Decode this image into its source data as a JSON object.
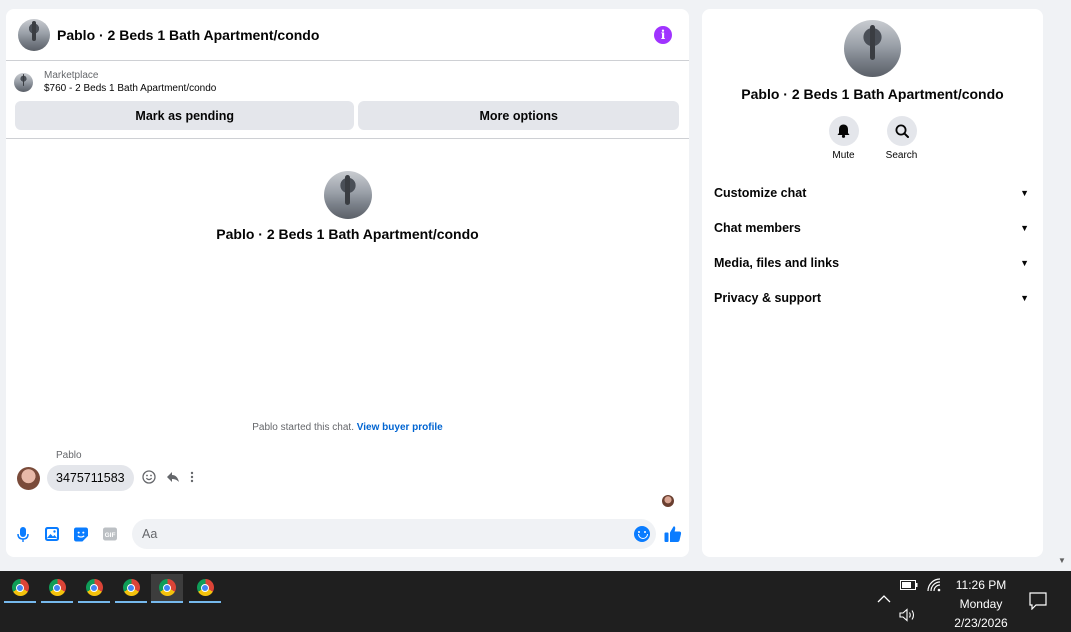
{
  "chat": {
    "title": "Pablo · 2 Beds 1 Bath Apartment/condo",
    "listing": {
      "kind": "Marketplace",
      "price_title": "$760 - 2 Beds 1 Bath Apartment/condo"
    },
    "actions": {
      "pending": "Mark as pending",
      "more": "More options"
    },
    "intro_title": "Pablo · 2 Beds 1 Bath Apartment/condo",
    "started_text": "Pablo started this chat.",
    "view_profile": "View buyer profile",
    "message": {
      "sender": "Pablo",
      "text": "3475711583"
    },
    "composer": {
      "placeholder": "Aa"
    },
    "accent_color": "#0a7cff",
    "info_color": "#a033ff"
  },
  "info_panel": {
    "title": "Pablo · 2 Beds 1 Bath Apartment/condo",
    "actions": [
      {
        "label": "Mute",
        "icon": "bell-icon"
      },
      {
        "label": "Search",
        "icon": "search-icon"
      }
    ],
    "sections": [
      "Customize chat",
      "Chat members",
      "Media, files and links",
      "Privacy & support"
    ]
  },
  "taskbar": {
    "apps": [
      "chrome-icon",
      "chrome-icon",
      "chrome-icon",
      "chrome-icon",
      "chrome-icon",
      "chrome-icon"
    ],
    "time": "11:26 PM",
    "day": "Monday",
    "date": "2/23/2026"
  }
}
